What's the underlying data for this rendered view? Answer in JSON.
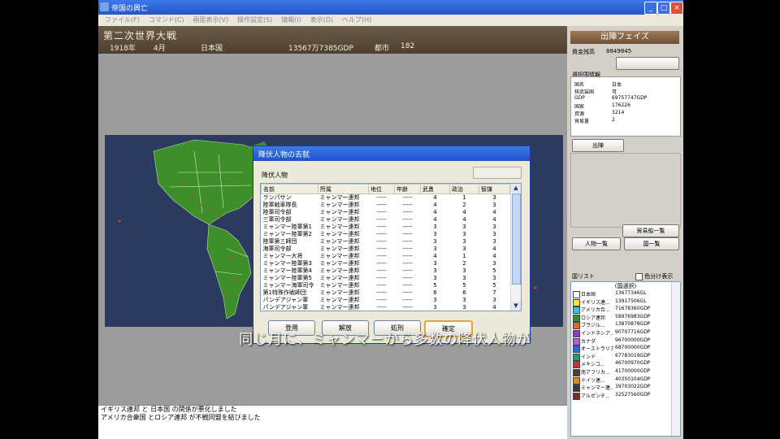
{
  "window": {
    "title": "帝国の興亡",
    "menu": [
      "ファイル(F)",
      "コマンド(C)",
      "画面表示(V)",
      "操作設定(S)",
      "情報(I)",
      "表示(D)",
      "ヘルプ(H)"
    ]
  },
  "header": {
    "war": "第二次世界大戦",
    "year": "1918年",
    "month": "4月",
    "country": "日本国",
    "gdp": "13567万7385GDP",
    "cities_label": "都市",
    "cities": "182"
  },
  "dialog": {
    "title": "降伏人物の去就",
    "group_label": "降伏人物",
    "columns": [
      "名前",
      "所属",
      "地位",
      "年齢",
      "武勇",
      "政治",
      "智謀"
    ],
    "rows": [
      [
        "ランパサン",
        "ミャンマー連邦",
        "-----",
        "-----",
        "4",
        "1",
        "3"
      ],
      [
        "陸軍戦車隊長",
        "ミャンマー連邦",
        "-----",
        "-----",
        "4",
        "2",
        "3"
      ],
      [
        "陸軍司令部",
        "ミャンマー連邦",
        "-----",
        "-----",
        "4",
        "4",
        "4"
      ],
      [
        "三軍司令部",
        "ミャンマー連邦",
        "-----",
        "-----",
        "4",
        "4",
        "4"
      ],
      [
        "ミャンマー陸軍第1",
        "ミャンマー連邦",
        "-----",
        "-----",
        "3",
        "3",
        "3"
      ],
      [
        "ミャンマー陸軍第2",
        "ミャンマー連邦",
        "-----",
        "-----",
        "3",
        "3",
        "3"
      ],
      [
        "陸軍第三師団",
        "ミャンマー連邦",
        "-----",
        "-----",
        "3",
        "3",
        "3"
      ],
      [
        "海軍司令部",
        "ミャンマー連邦",
        "-----",
        "-----",
        "3",
        "3",
        "4"
      ],
      [
        "ミャンマー大将",
        "ミャンマー連邦",
        "-----",
        "-----",
        "4",
        "1",
        "4"
      ],
      [
        "ミャンマー陸軍第3",
        "ミャンマー連邦",
        "-----",
        "-----",
        "3",
        "2",
        "3"
      ],
      [
        "ミャンマー陸軍第4",
        "ミャンマー連邦",
        "-----",
        "-----",
        "3",
        "3",
        "5"
      ],
      [
        "ミャンマー陸軍第5",
        "ミャンマー連邦",
        "-----",
        "-----",
        "3",
        "3",
        "3"
      ],
      [
        "ミャンマー海軍司令",
        "ミャンマー連邦",
        "-----",
        "-----",
        "5",
        "5",
        "5"
      ],
      [
        "第1特殊作戦師団",
        "ミャンマー連邦",
        "-----",
        "-----",
        "6",
        "6",
        "7"
      ],
      [
        "パンデアジャン軍",
        "ミャンマー連邦",
        "-----",
        "-----",
        "3",
        "3",
        "3"
      ],
      [
        "パンデアジャン軍",
        "ミャンマー連邦",
        "-----",
        "-----",
        "3",
        "3",
        "4"
      ]
    ],
    "buttons": [
      "登用",
      "解放",
      "処刑",
      "確定"
    ]
  },
  "subtitle": "同じ月に、ミャンマーから多数の降伏人物が",
  "log": [
    "イギリス連邦 と 日本国 の関係が悪化しました",
    "アメリカ合衆国 とロシア連邦 が不戦同盟を結びました"
  ],
  "right_panel": {
    "phase_title": "出陣フェイズ",
    "funds_label": "資金残高",
    "funds_value": "8849845",
    "top_button": "",
    "selected_label": "選択国情報",
    "info_rows": [
      {
        "k": "国名",
        "v": "日本"
      },
      {
        "k": "核武装国",
        "v": "可"
      },
      {
        "k": "GDP",
        "v": "69757747GDP"
      },
      {
        "k": "国家",
        "v": "176226"
      },
      {
        "k": "資源",
        "v": "3214"
      },
      {
        "k": "貿易量",
        "v": "2"
      }
    ],
    "deploy_button": "出陣",
    "trade_button": "貿易船一覧",
    "person_button": "人物一覧",
    "country_button": "国一覧",
    "list_label": "国リスト",
    "color_checkbox": "色分け表示",
    "list_header": "(国選択)",
    "countries": [
      {
        "name": "日本国",
        "gdp": "13677346GL",
        "color": "#ffffff"
      },
      {
        "name": "イギリス連...",
        "gdp": "13917506GL",
        "color": "#f3e33a"
      },
      {
        "name": "アメリカ合...",
        "gdp": "71678360GDP",
        "color": "#3ac0d8"
      },
      {
        "name": "ロシア連邦",
        "gdp": "58976983GDP",
        "color": "#2f8f3f"
      },
      {
        "name": "ブラジル...",
        "gdp": "13870878GDP",
        "color": "#e06a2a"
      },
      {
        "name": "インドネシア...",
        "gdp": "90707716GDP",
        "color": "#8a3fc0"
      },
      {
        "name": "カナダ",
        "gdp": "96700000GDP",
        "color": "#b060d0"
      },
      {
        "name": "オーストラリア",
        "gdp": "68700000GDP",
        "color": "#2a6ad8"
      },
      {
        "name": "インド",
        "gdp": "67783019GDP",
        "color": "#2a9c60"
      },
      {
        "name": "メキシコ...",
        "gdp": "46700970GDP",
        "color": "#c03a3a"
      },
      {
        "name": "南アフリカ...",
        "gdp": "41700000GDP",
        "color": "#5a3a2a"
      },
      {
        "name": "ドイツ連...",
        "gdp": "40350104GDP",
        "color": "#d88a2a"
      },
      {
        "name": "ミャンマー連...",
        "gdp": "39703022GDP",
        "color": "#3a3a3a"
      },
      {
        "name": "アルゼンチ...",
        "gdp": "32527560GDP",
        "color": "#7a2a2a"
      }
    ]
  }
}
